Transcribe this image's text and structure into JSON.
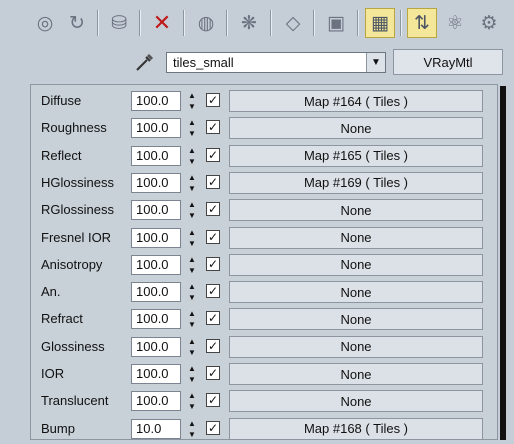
{
  "toolbar": {
    "icons": [
      "get-material-icon",
      "put-to-scene-icon",
      "assign-material-icon",
      "delete-icon",
      "make-unique-icon",
      "put-to-library-icon",
      "material-id-icon",
      "show-in-viewport-icon",
      "show-background-icon",
      "show-end-result-icon",
      "go-to-parent-icon",
      "go-forward-icon"
    ],
    "accent_color": "#f4e79a"
  },
  "material": {
    "name": "tiles_small",
    "type_button": "VRayMtl"
  },
  "rows": [
    {
      "label": "Diffuse",
      "value": "100.0",
      "checked": true,
      "map": "Map #164  ( Tiles )"
    },
    {
      "label": "Roughness",
      "value": "100.0",
      "checked": true,
      "map": "None"
    },
    {
      "label": "Reflect",
      "value": "100.0",
      "checked": true,
      "map": "Map #165  ( Tiles )"
    },
    {
      "label": "HGlossiness",
      "value": "100.0",
      "checked": true,
      "map": "Map #169  ( Tiles )"
    },
    {
      "label": "RGlossiness",
      "value": "100.0",
      "checked": true,
      "map": "None"
    },
    {
      "label": "Fresnel IOR",
      "value": "100.0",
      "checked": true,
      "map": "None"
    },
    {
      "label": "Anisotropy",
      "value": "100.0",
      "checked": true,
      "map": "None"
    },
    {
      "label": "An.",
      "value": "100.0",
      "checked": true,
      "map": "None"
    },
    {
      "label": "Refract",
      "value": "100.0",
      "checked": true,
      "map": "None"
    },
    {
      "label": "Glossiness",
      "value": "100.0",
      "checked": true,
      "map": "None"
    },
    {
      "label": "IOR",
      "value": "100.0",
      "checked": true,
      "map": "None"
    },
    {
      "label": "Translucent",
      "value": "100.0",
      "checked": true,
      "map": "None"
    },
    {
      "label": "Bump",
      "value": "10.0",
      "checked": true,
      "map": "Map #168  ( Tiles )"
    }
  ]
}
